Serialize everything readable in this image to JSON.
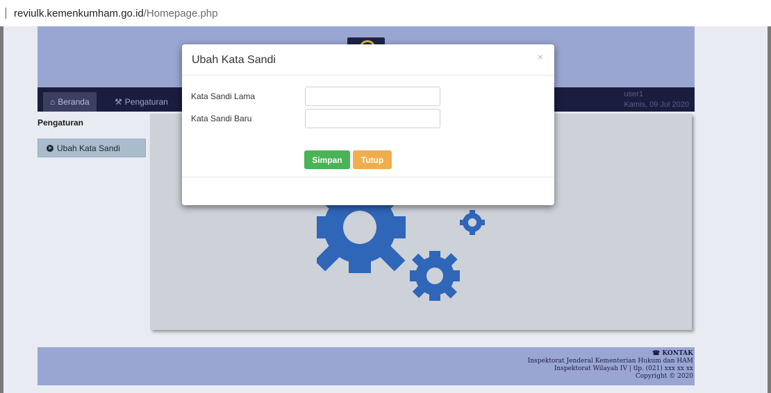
{
  "browser": {
    "url_host": "reviulk.kemenkumham.go.id",
    "url_path": "/Homepage.php"
  },
  "nav": {
    "items": [
      {
        "label": "Beranda",
        "icon": "home-icon"
      },
      {
        "label": "Pengaturan",
        "icon": "wrench-icon"
      }
    ],
    "user": "user1",
    "date": "Kamis, 09 Jul 2020"
  },
  "sidebar": {
    "title": "Pengaturan",
    "button_label": "Ubah Kata Sandi"
  },
  "footer": {
    "heading": "KONTAK",
    "line1": "Inspektorat Jenderal Kementerian Hukum dan HAM",
    "line2": "Inspektorat Wilayah IV | tlp. (021) xxx xx xx",
    "line3": "Copyright © 2020"
  },
  "modal": {
    "title": "Ubah Kata Sandi",
    "close_symbol": "×",
    "fields": [
      {
        "label": "Kata Sandi Lama",
        "value": ""
      },
      {
        "label": "Kata Sandi Baru",
        "value": ""
      }
    ],
    "save_label": "Simpan",
    "close_label": "Tutup"
  },
  "colors": {
    "banner": "#9aa6d2",
    "navbar": "#1b1d3f",
    "save": "#4ab356",
    "close": "#efad4d",
    "gear": "#3b78c8"
  }
}
